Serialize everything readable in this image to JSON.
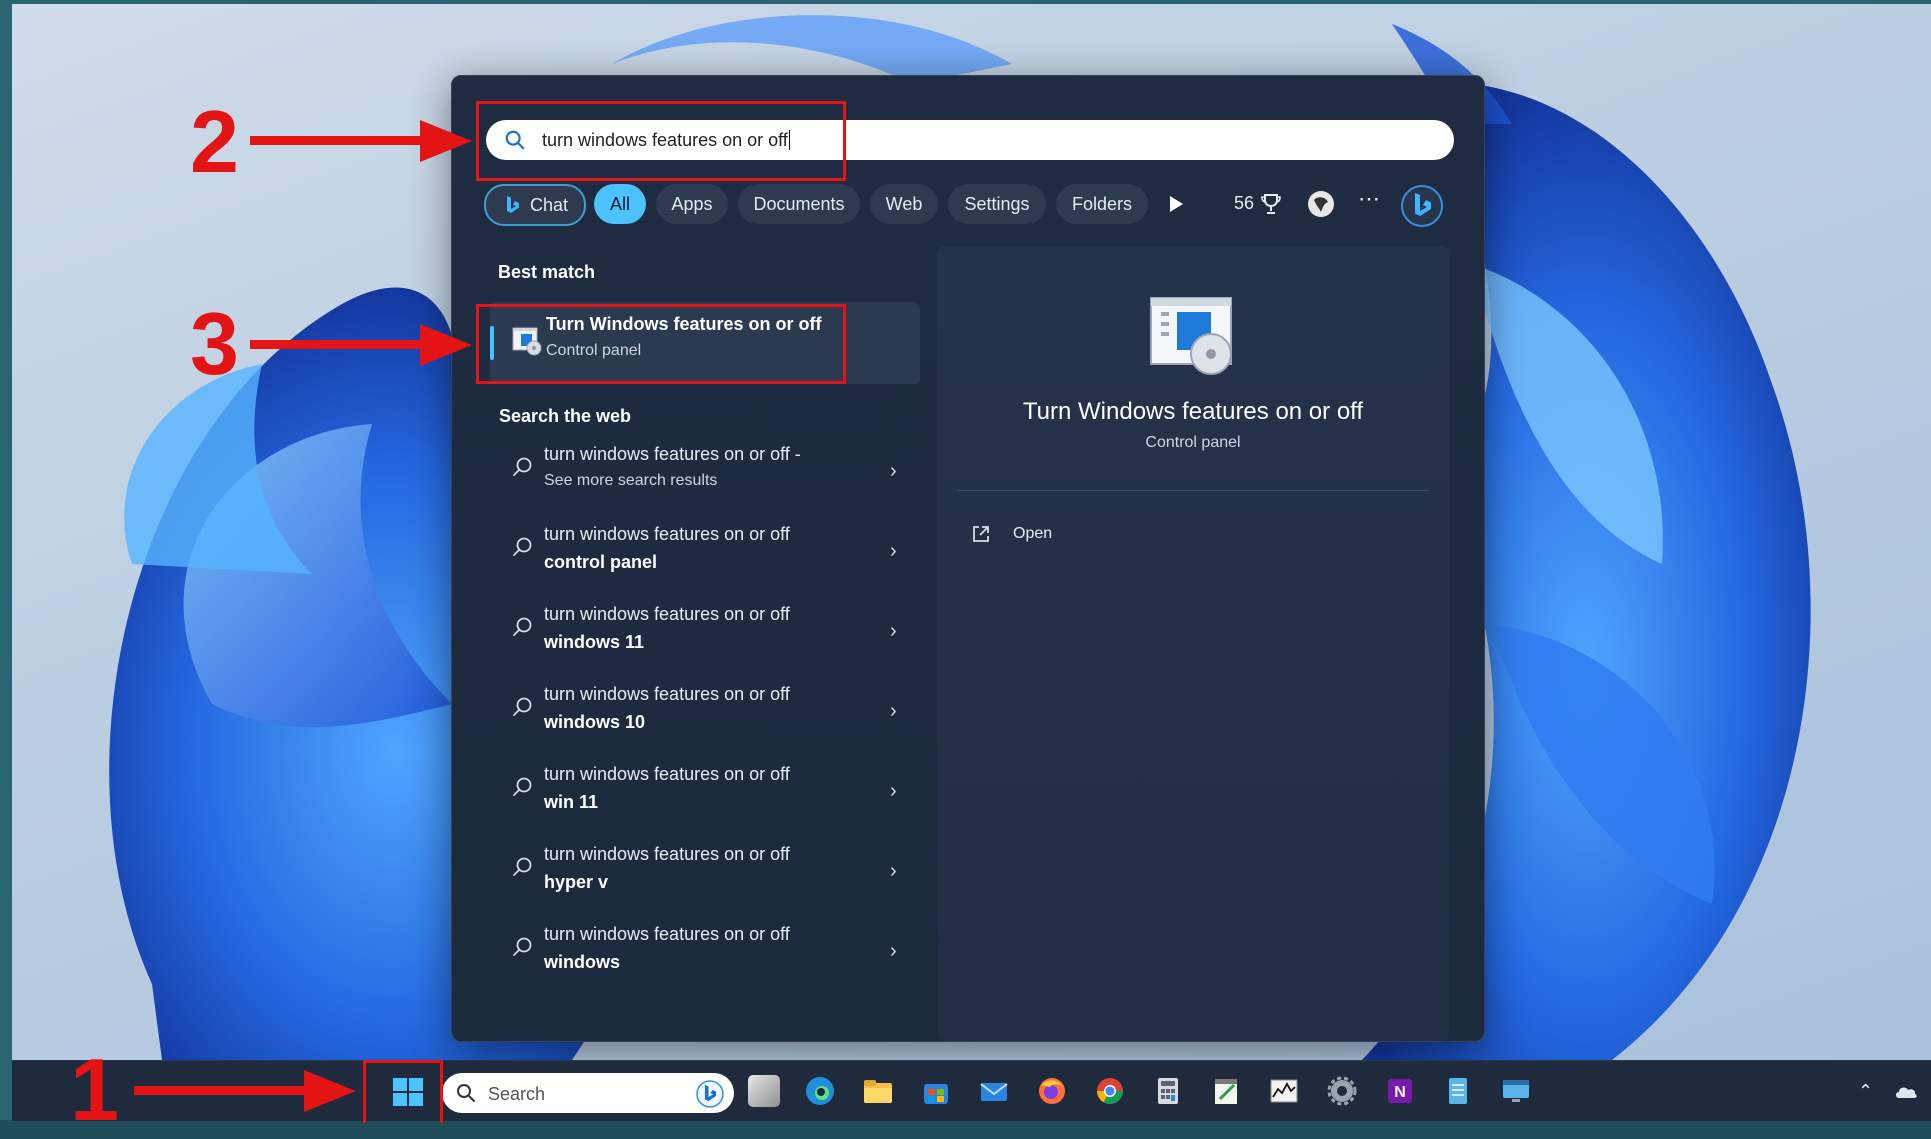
{
  "search": {
    "query": "turn windows features on or off"
  },
  "filters": {
    "chat": "Chat",
    "all": "All",
    "apps": "Apps",
    "documents": "Documents",
    "web": "Web",
    "settings": "Settings",
    "folders": "Folders",
    "points": "56"
  },
  "best_match": {
    "heading": "Best match",
    "title": "Turn Windows features on or off",
    "subtitle": "Control panel"
  },
  "web": {
    "heading": "Search the web",
    "items": [
      {
        "line1": "turn windows features on or off -",
        "line2": "See more search results"
      },
      {
        "line1": "turn windows features on or off",
        "line2": "control panel"
      },
      {
        "line1": "turn windows features on or off",
        "line2": "windows 11"
      },
      {
        "line1": "turn windows features on or off",
        "line2": "windows 10"
      },
      {
        "line1": "turn windows features on or off",
        "line2": "win 11"
      },
      {
        "line1": "turn windows features on or off",
        "line2": "hyper v"
      },
      {
        "line1": "turn windows features on or off",
        "line2": "windows"
      }
    ]
  },
  "preview": {
    "title": "Turn Windows features on or off",
    "subtitle": "Control panel",
    "open_label": "Open"
  },
  "taskbar": {
    "search_placeholder": "Search"
  },
  "annotations": {
    "step1": "1",
    "step2": "2",
    "step3": "3",
    "color": "#e31414"
  },
  "colors": {
    "accent": "#4cc2ff",
    "panel": "#1e2b40",
    "taskbar": "#1f2a3c"
  }
}
